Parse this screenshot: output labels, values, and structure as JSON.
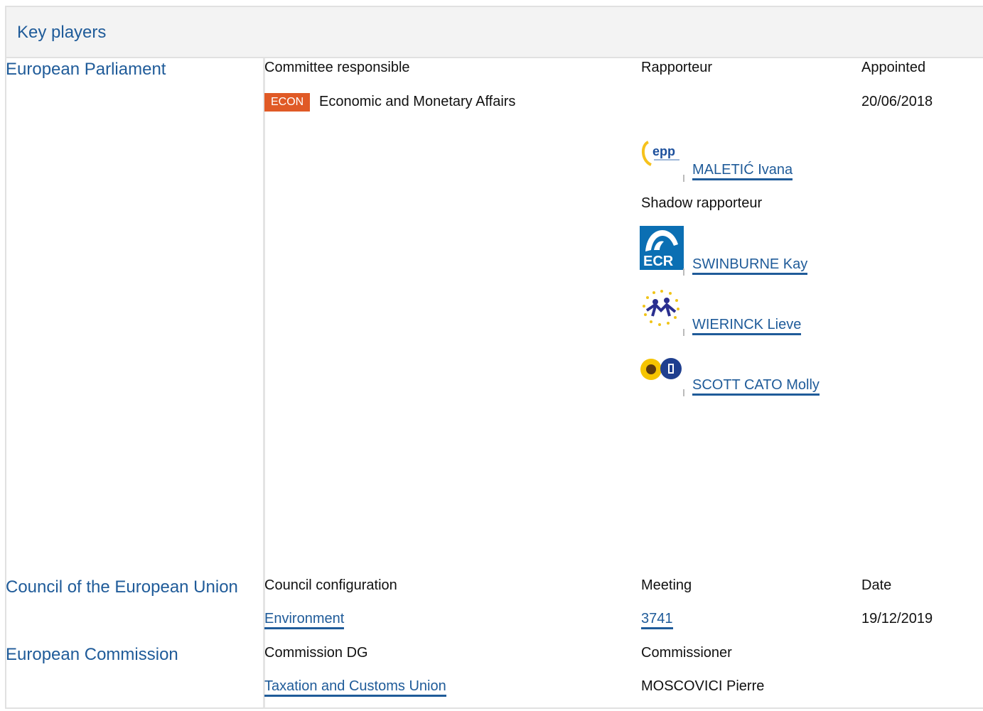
{
  "header": {
    "title": "Key players"
  },
  "parliament": {
    "label": "European Parliament",
    "col_committee": "Committee responsible",
    "col_rapporteur": "Rapporteur",
    "col_appointed": "Appointed",
    "committee_badge": "ECON",
    "committee_name": "Economic and Monetary Affairs",
    "appointed_date": "20/06/2018",
    "rapporteur": {
      "name": "MALETIĆ Ivana",
      "group_icon": "epp-logo-icon"
    },
    "shadow_label": "Shadow rapporteur",
    "shadows": [
      {
        "name": "SWINBURNE Kay",
        "group_icon": "ecr-logo-icon"
      },
      {
        "name": "WIERINCK Lieve",
        "group_icon": "alde-logo-icon"
      },
      {
        "name": "SCOTT CATO Molly",
        "group_icon": "greens-efa-logo-icon"
      }
    ]
  },
  "council": {
    "label": "Council of the European Union",
    "col_config": "Council configuration",
    "col_meeting": "Meeting",
    "col_date": "Date",
    "config": "Environment",
    "meeting": "3741",
    "date": "19/12/2019"
  },
  "commission": {
    "label": "European Commission",
    "col_dg": "Commission DG",
    "col_commissioner": "Commissioner",
    "dg": "Taxation and Customs Union",
    "commissioner": "MOSCOVICI Pierre"
  },
  "colors": {
    "link": "#1f5b99",
    "badge": "#e05a26",
    "header_bg": "#f3f3f3",
    "border": "#e1e1e1"
  }
}
